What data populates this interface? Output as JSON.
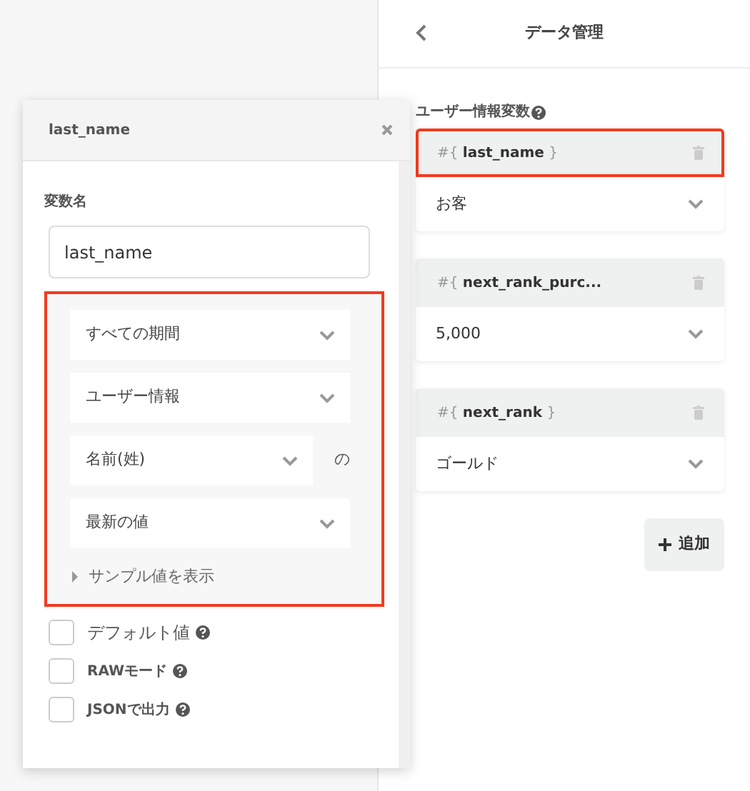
{
  "panel": {
    "title": "データ管理",
    "section_label": "ユーザー情報変数",
    "variables": [
      {
        "name": "#{ **last_name** }",
        "value": "お客",
        "highlighted": true
      },
      {
        "name": "#{ **next_rank_purc...**",
        "value": "5,000",
        "highlighted": false
      },
      {
        "name": "#{ **next_rank** }",
        "value": "ゴールド",
        "highlighted": false
      }
    ],
    "add_button": "追加"
  },
  "popup": {
    "title": "last_name",
    "field_label": "変数名",
    "field_value": "last_name",
    "settings": {
      "highlighted": true,
      "dropdowns": [
        {
          "value": "すべての期間"
        },
        {
          "value": "ユーザー情報"
        },
        {
          "value": "名前(姓)",
          "suffix": "の"
        },
        {
          "value": "最新の値"
        }
      ],
      "sample_toggle": {
        "label": "サンプル値を表示",
        "expanded": false
      }
    },
    "options": [
      {
        "label": "デフォルト値",
        "checked": false,
        "bold": false
      },
      {
        "label": "RAWモード",
        "checked": false,
        "bold": true
      },
      {
        "label": "JSONで出力",
        "checked": false,
        "bold": true
      }
    ]
  }
}
